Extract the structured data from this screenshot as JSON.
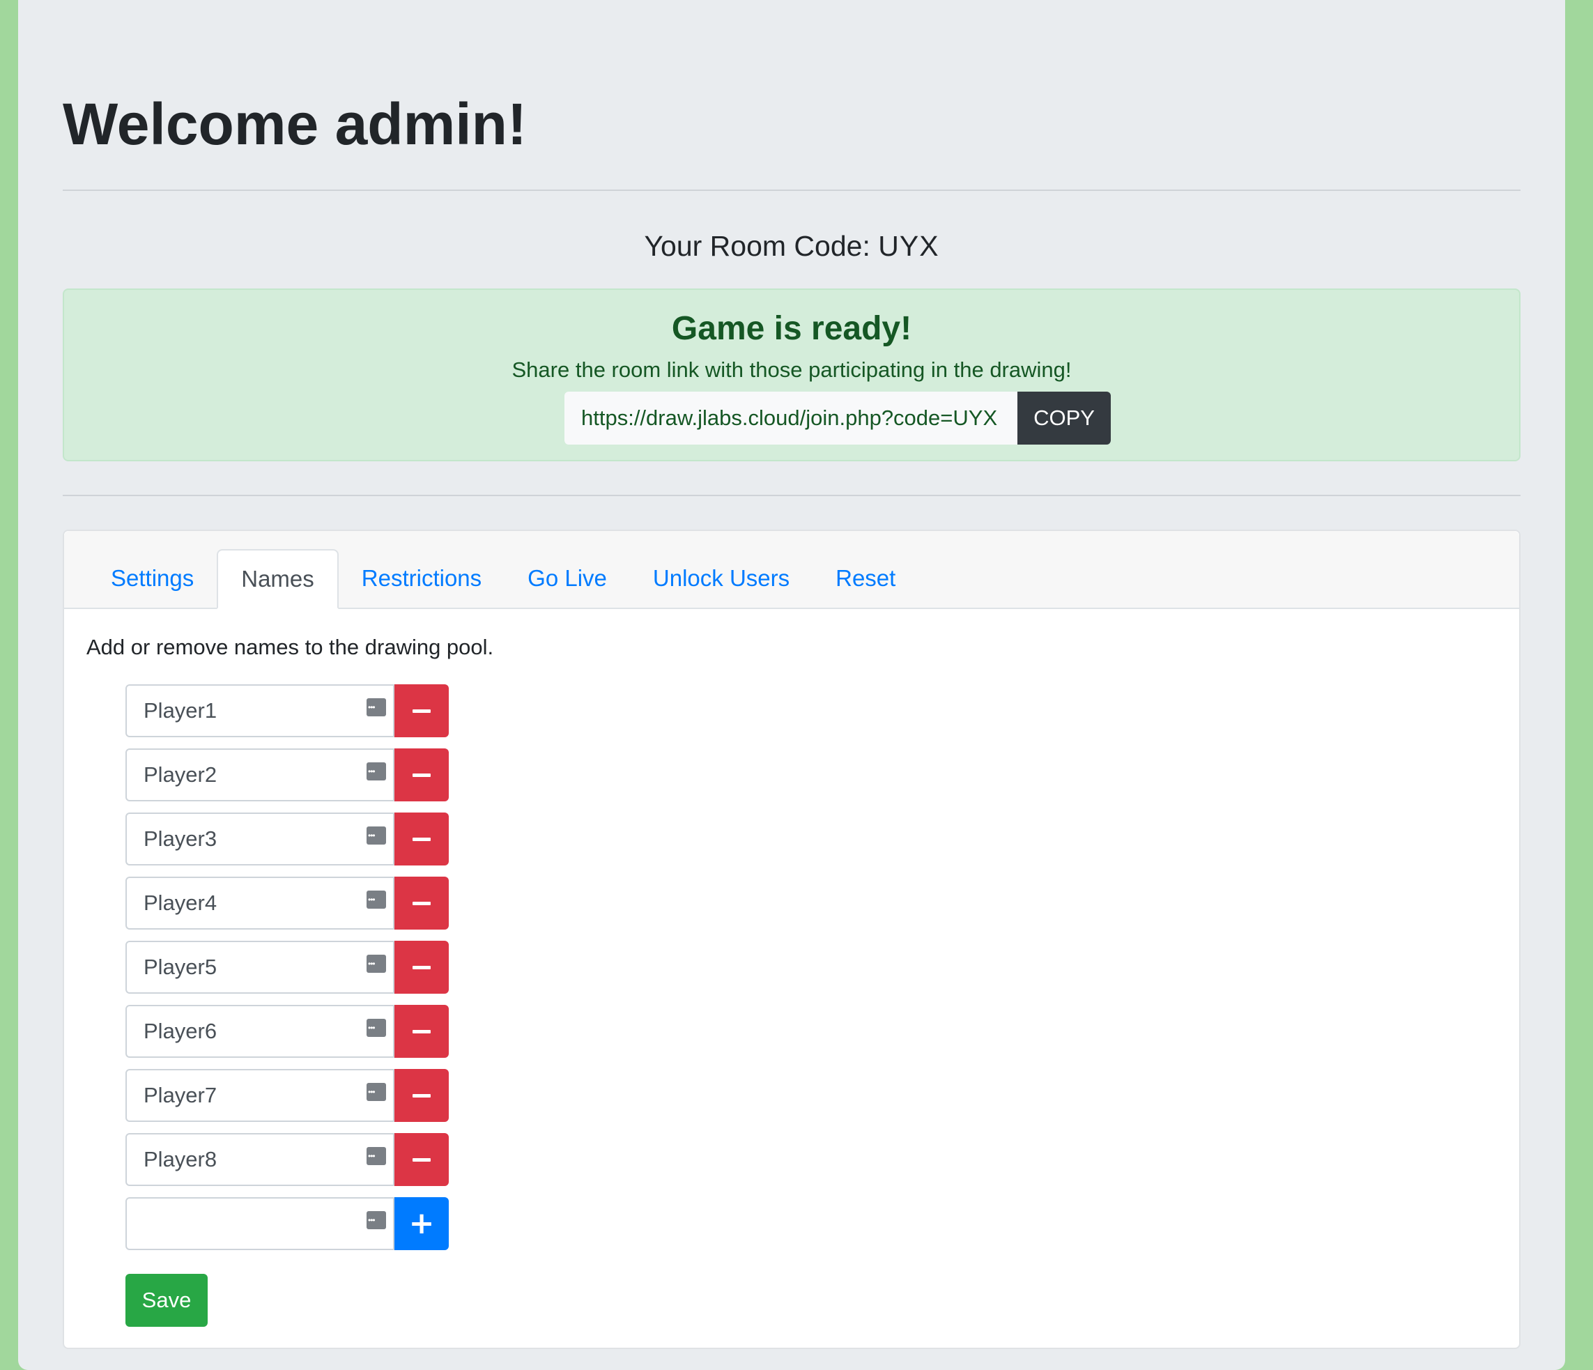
{
  "header": {
    "title": "Welcome admin!"
  },
  "room": {
    "label": "Your Room Code: ",
    "code": "UYX"
  },
  "alert": {
    "heading": "Game is ready!",
    "message": "Share the room link with those participating in the drawing!",
    "link": "https://draw.jlabs.cloud/join.php?code=UYX",
    "copy_label": "COPY"
  },
  "tabs": [
    {
      "label": "Settings"
    },
    {
      "label": "Names"
    },
    {
      "label": "Restrictions"
    },
    {
      "label": "Go Live"
    },
    {
      "label": "Unlock Users"
    },
    {
      "label": "Reset"
    }
  ],
  "active_tab": "Names",
  "names_panel": {
    "intro": "Add or remove names to the drawing pool.",
    "names": [
      "Player1",
      "Player2",
      "Player3",
      "Player4",
      "Player5",
      "Player6",
      "Player7",
      "Player8"
    ],
    "new_name_value": "",
    "save_label": "Save"
  },
  "colors": {
    "page_bg": "#a1d79c",
    "remove": "#dc3545",
    "add": "#007bff",
    "save": "#28a745",
    "alert_text": "#155724"
  },
  "icons": {
    "input_icon": "dots-icon",
    "remove": "minus-icon",
    "add": "plus-icon"
  }
}
